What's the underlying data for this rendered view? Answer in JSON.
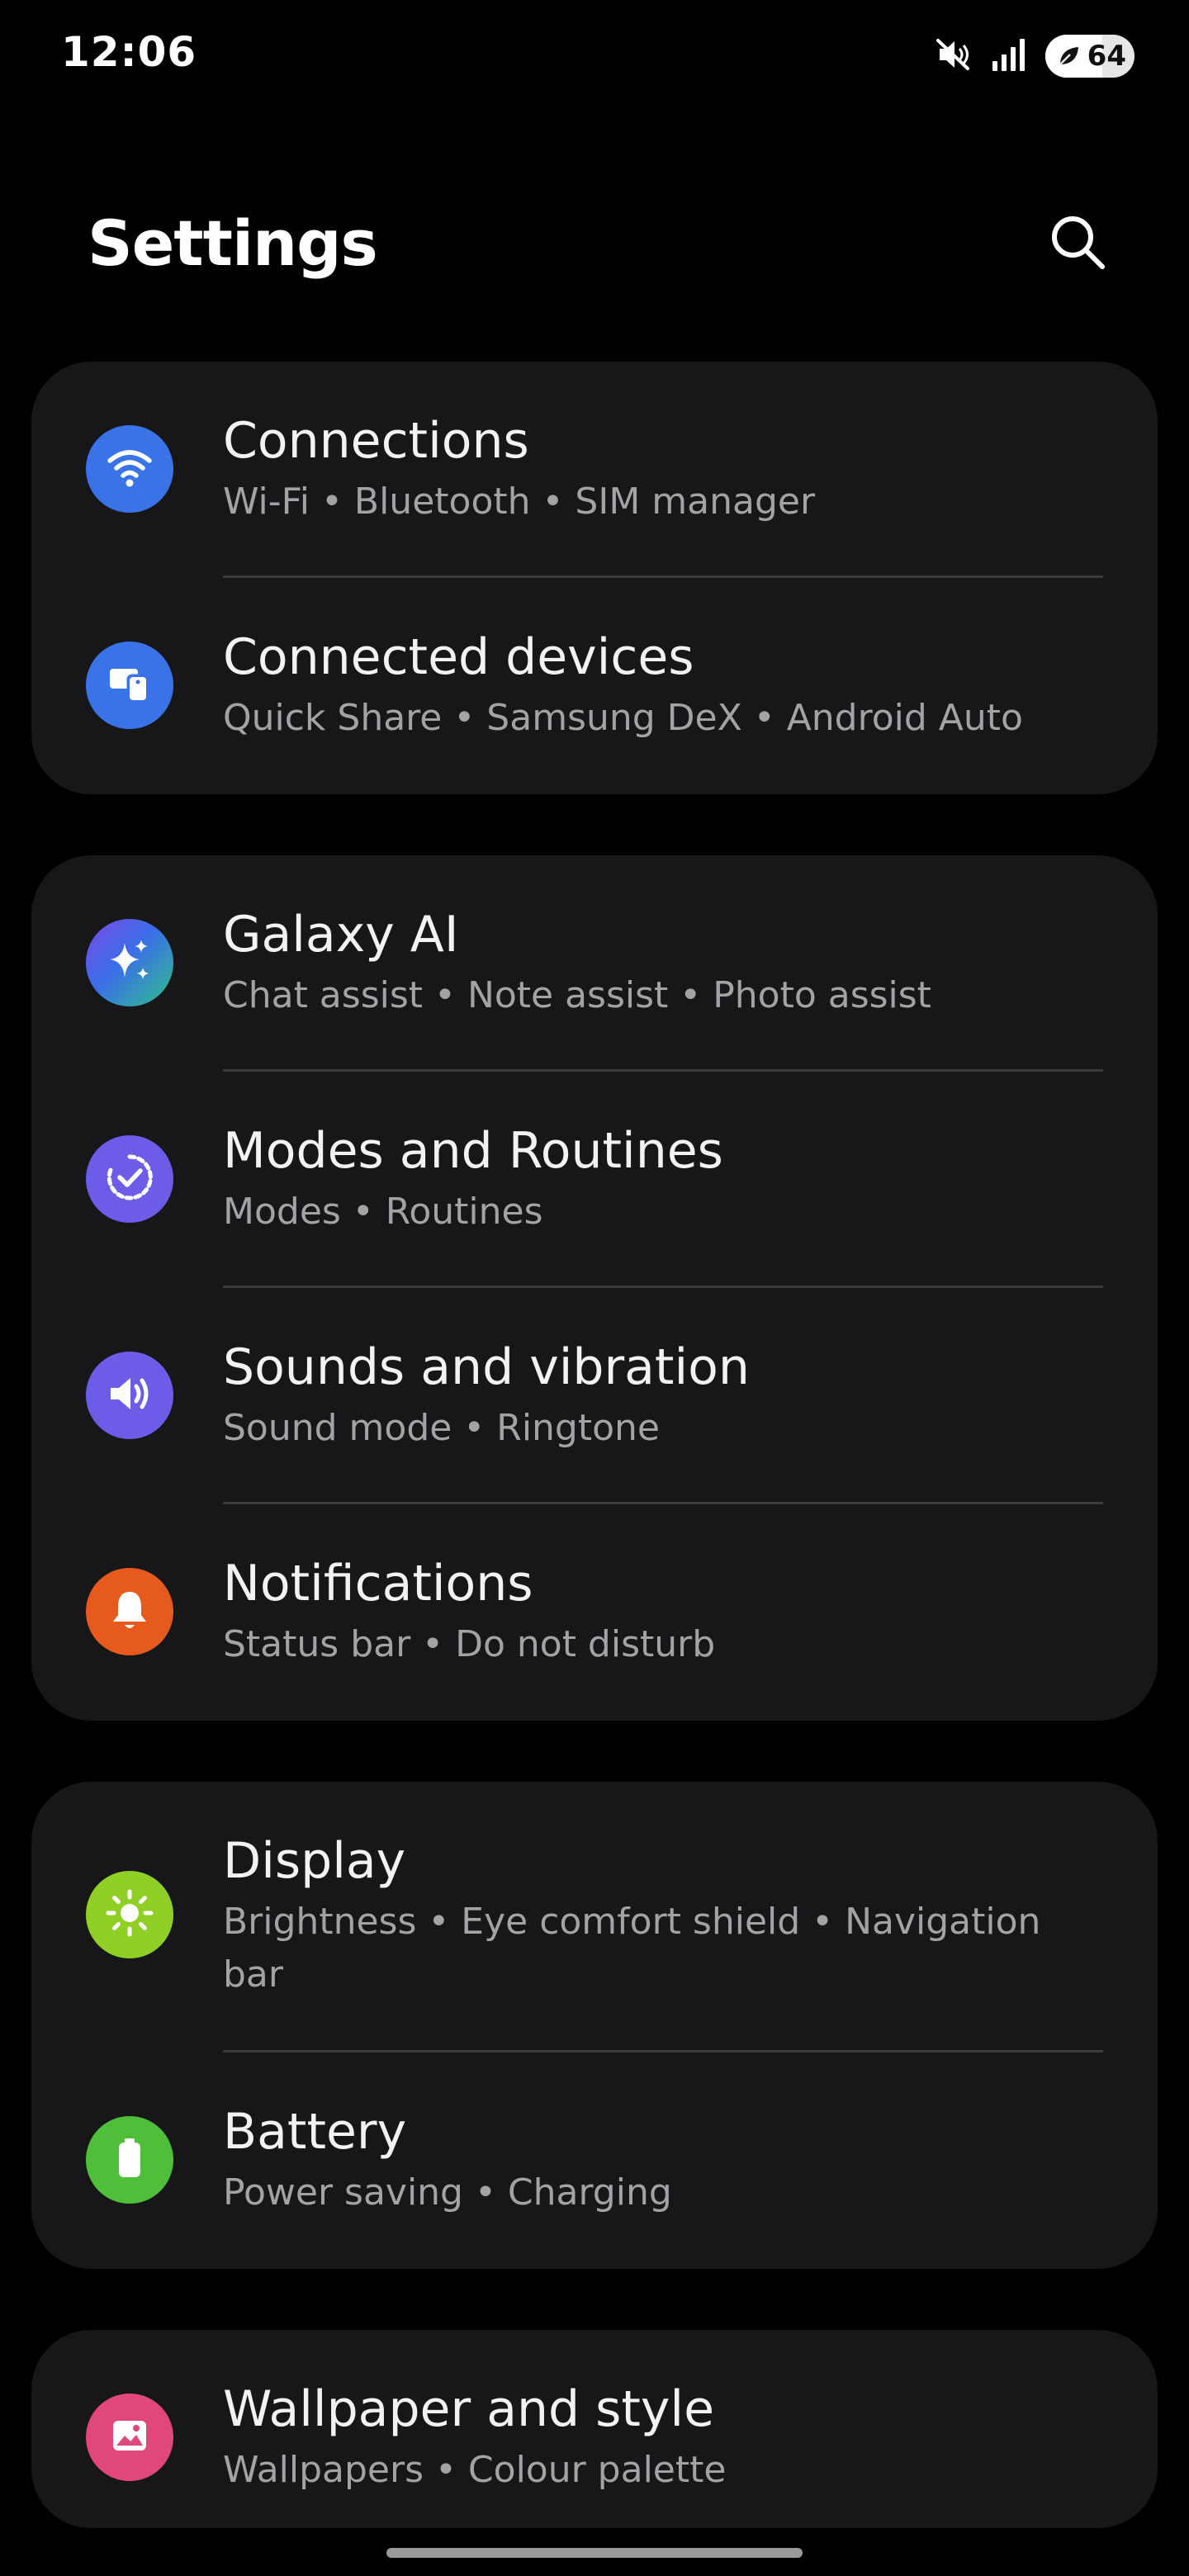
{
  "status_bar": {
    "time": "12:06",
    "battery_level": "64",
    "battery_fraction": 0.64
  },
  "header": {
    "title": "Settings",
    "search_icon": "search-icon"
  },
  "groups": [
    {
      "items": [
        {
          "title": "Connections",
          "subtitle": "Wi-Fi  •  Bluetooth  •  SIM manager",
          "icon": "wifi-icon",
          "color": "#3a73e8"
        },
        {
          "title": "Connected devices",
          "subtitle": "Quick Share  •  Samsung DeX  •  Android Auto",
          "icon": "devices-icon",
          "color": "#3a73e8"
        }
      ]
    },
    {
      "items": [
        {
          "title": "Galaxy AI",
          "subtitle": "Chat assist  •  Note assist  •  Photo assist",
          "icon": "sparkle-icon",
          "color": "#4a6ee0"
        },
        {
          "title": "Modes and Routines",
          "subtitle": "Modes  •  Routines",
          "icon": "routine-check-icon",
          "color": "#6d5ce8"
        },
        {
          "title": "Sounds and vibration",
          "subtitle": "Sound mode  •  Ringtone",
          "icon": "speaker-icon",
          "color": "#6d5ce8"
        },
        {
          "title": "Notifications",
          "subtitle": "Status bar  •  Do not disturb",
          "icon": "bell-icon",
          "color": "#e65a1e"
        }
      ]
    },
    {
      "items": [
        {
          "title": "Display",
          "subtitle": "Brightness  •  Eye comfort shield  •  Navigation bar",
          "icon": "sun-icon",
          "color": "#8fcf26"
        },
        {
          "title": "Battery",
          "subtitle": "Power saving  •  Charging",
          "icon": "battery-icon",
          "color": "#4fbf3a"
        }
      ]
    },
    {
      "items": [
        {
          "title": "Wallpaper and style",
          "subtitle": "Wallpapers  •  Colour palette",
          "icon": "image-icon",
          "color": "#e0487a"
        }
      ]
    }
  ]
}
